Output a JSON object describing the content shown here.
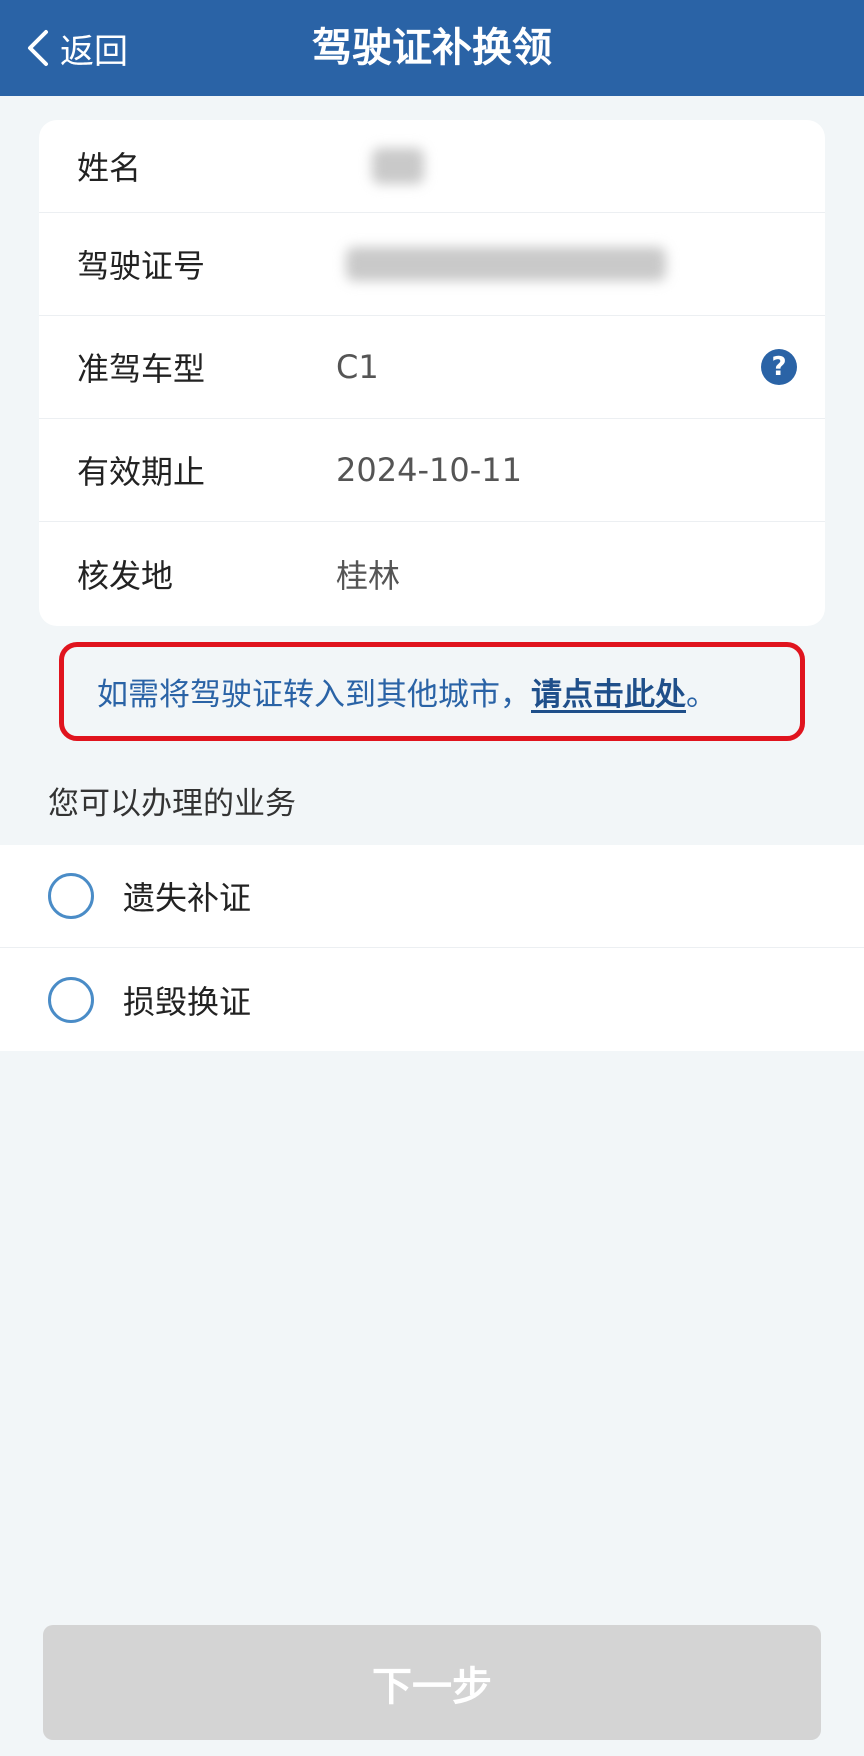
{
  "navbar": {
    "back_label": "返回",
    "title": "驾驶证补换领"
  },
  "info": {
    "rows": [
      {
        "label": "姓名",
        "value": ""
      },
      {
        "label": "驾驶证号",
        "value": ""
      },
      {
        "label": "准驾车型",
        "value": "C1"
      },
      {
        "label": "有效期止",
        "value": "2024-10-11"
      },
      {
        "label": "核发地",
        "value": "桂林"
      }
    ],
    "help_icon": "?"
  },
  "notice": {
    "text": "如需将驾驶证转入到其他城市，",
    "link": "请点击此处",
    "suffix": "。"
  },
  "services": {
    "title": "您可以办理的业务",
    "options": [
      {
        "label": "遗失补证",
        "selected": false
      },
      {
        "label": "损毁换证",
        "selected": false
      }
    ]
  },
  "next_button": {
    "label": "下一步",
    "enabled": false
  },
  "colors": {
    "primary": "#2a63a6",
    "highlight_border": "#e0141e",
    "disabled_button": "#d4d4d4",
    "radio_border": "#4a8cc7",
    "page_background": "#f2f6f8"
  }
}
